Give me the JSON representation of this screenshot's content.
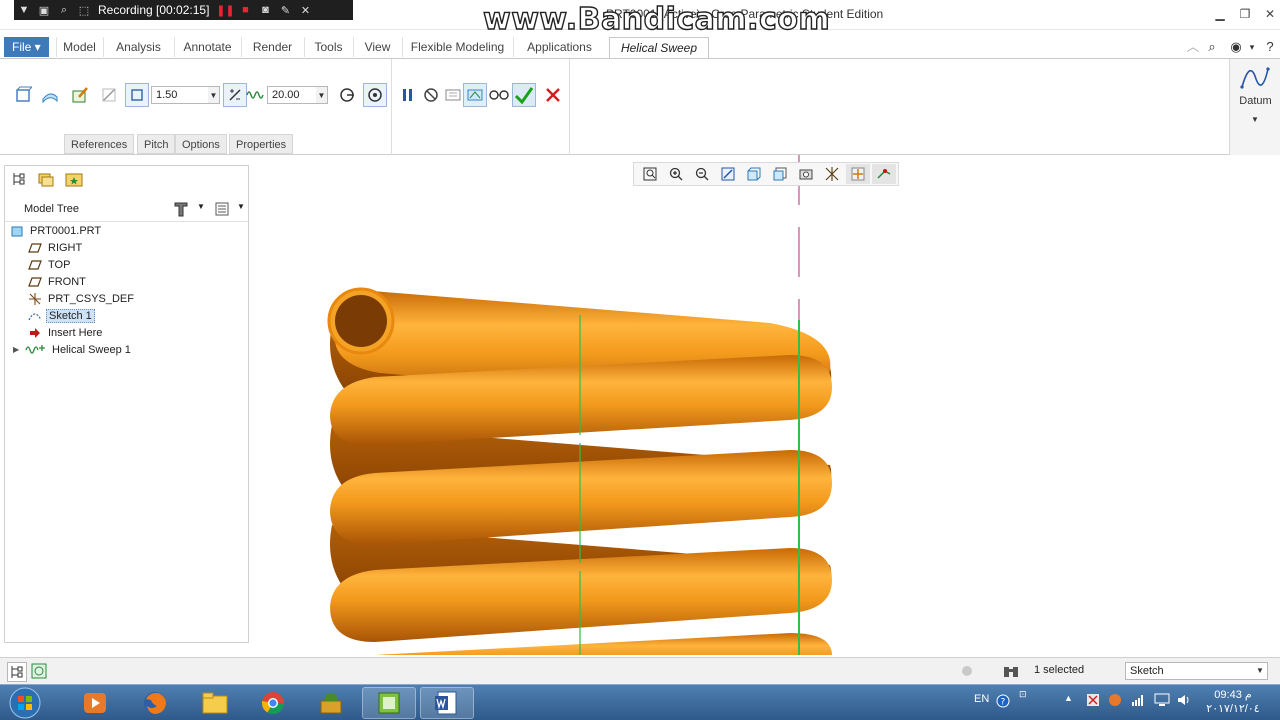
{
  "titlebar": {
    "app_title": "PRT0001 (Active) - Creo Parametric Student Edition",
    "watermark": "www.Bandicam.com",
    "recording_label": "Recording [00:02:15]"
  },
  "menu": {
    "file": "File",
    "tabs": [
      "Model",
      "Analysis",
      "Annotate",
      "Render",
      "Tools",
      "View",
      "Flexible Modeling",
      "Applications"
    ],
    "active_tab": "Helical Sweep"
  },
  "ribbon": {
    "profile_value": "1.50",
    "pitch_value": "20.00",
    "subtabs": [
      "References",
      "Pitch",
      "Options",
      "Properties"
    ],
    "datum_label": "Datum"
  },
  "model_tree": {
    "title": "Model Tree",
    "items": [
      {
        "label": "PRT0001.PRT",
        "icon": "part-icon"
      },
      {
        "label": "RIGHT",
        "icon": "datum-plane-icon"
      },
      {
        "label": "TOP",
        "icon": "datum-plane-icon"
      },
      {
        "label": "FRONT",
        "icon": "datum-plane-icon"
      },
      {
        "label": "PRT_CSYS_DEF",
        "icon": "csys-icon"
      },
      {
        "label": "Sketch 1",
        "icon": "sketch-icon",
        "selected": true
      },
      {
        "label": "Insert Here",
        "icon": "insert-arrow-icon"
      },
      {
        "label": "Helical Sweep 1",
        "icon": "helical-sweep-icon"
      }
    ]
  },
  "status": {
    "selection_text": "1 selected",
    "filter_value": "Sketch"
  },
  "taskbar": {
    "language": "EN",
    "clock_time": "09:43 م",
    "clock_date": "٢٠١٧/١٢/٠٤"
  },
  "colors": {
    "spring_orange": "#f39a1c",
    "axis_green": "#2fbf4a",
    "axis_magenta": "#b0307a",
    "file_blue": "#3f7ab8",
    "ok_green": "#1aa21a",
    "cancel_red": "#d02020"
  }
}
